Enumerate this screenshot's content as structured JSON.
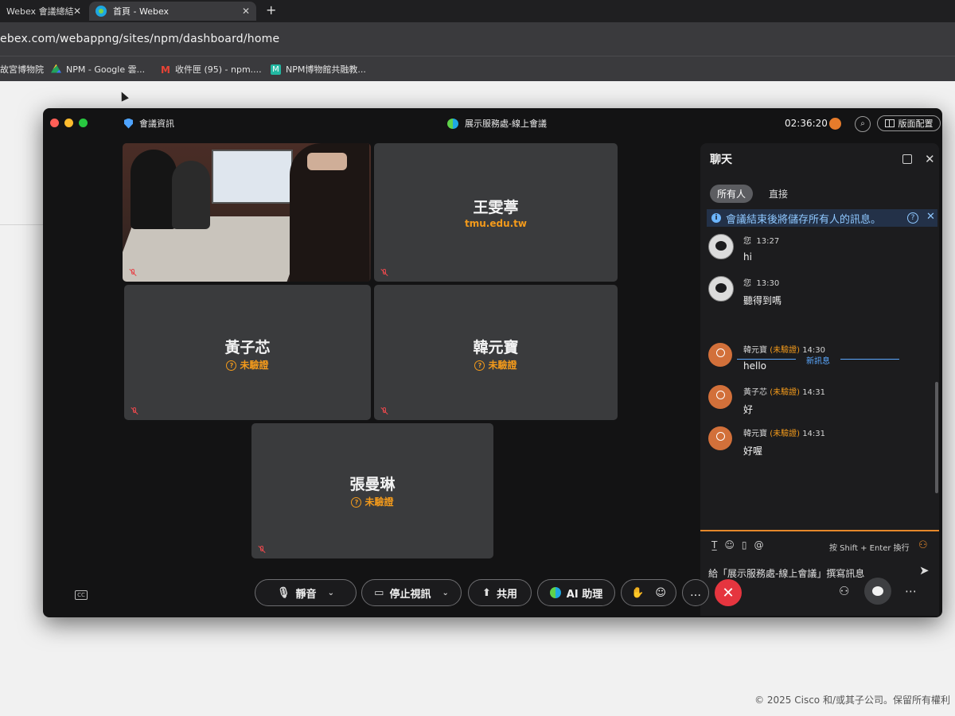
{
  "browser": {
    "tabs": [
      {
        "title": "Webex 會議總結",
        "active": false
      },
      {
        "title": "首頁 - Webex",
        "active": true
      }
    ],
    "url": "ebex.com/webappng/sites/npm/dashboard/home",
    "bookmarks": [
      "故宮博物院",
      "NPM - Google 雲...",
      "收件匣 (95) - npm....",
      "NPM博物館共融教..."
    ]
  },
  "page": {
    "copyright": "© 2025 Cisco 和/或其子公司。保留所有權利"
  },
  "meeting": {
    "info_label": "會議資訊",
    "title": "展示服務處-線上會議",
    "time": "02:36:20",
    "layout_label": "版面配置",
    "participants": [
      {
        "name": "王雯葶",
        "sub": "tmu.edu.tw",
        "unverified": false
      },
      {
        "name": "黃子芯",
        "sub": "未驗證",
        "unverified": true
      },
      {
        "name": "韓元寶",
        "sub": "未驗證",
        "unverified": true
      },
      {
        "name": "張曼琳",
        "sub": "未驗證",
        "unverified": true
      }
    ]
  },
  "chat": {
    "title": "聊天",
    "tabs": [
      "所有人",
      "直接"
    ],
    "notice": "會議結束後將儲存所有人的訊息。",
    "new_messages_label": "新訊息",
    "messages": [
      {
        "sender": "您",
        "time": "13:27",
        "text": "hi",
        "unverified_label": ""
      },
      {
        "sender": "您",
        "time": "13:30",
        "text": "聽得到嗎",
        "unverified_label": ""
      },
      {
        "sender": "韓元寶",
        "time": "14:30",
        "text": "hello",
        "unverified_label": "(未驗證)"
      },
      {
        "sender": "黃子芯",
        "time": "14:31",
        "text": "好",
        "unverified_label": "(未驗證)"
      },
      {
        "sender": "韓元寶",
        "time": "14:31",
        "text": "好喔",
        "unverified_label": "(未驗證)"
      }
    ],
    "shift_hint": "按 Shift + Enter 換行",
    "placeholder": "給「展示服務處-線上會議」撰寫訊息"
  },
  "controls": {
    "mute": "靜音",
    "stop_video": "停止視訊",
    "share": "共用",
    "ai_assistant": "AI 助理"
  },
  "colors": {
    "unverified": "#f39a1b",
    "end_call": "#e5353f",
    "notice_text": "#8fc8ff"
  }
}
